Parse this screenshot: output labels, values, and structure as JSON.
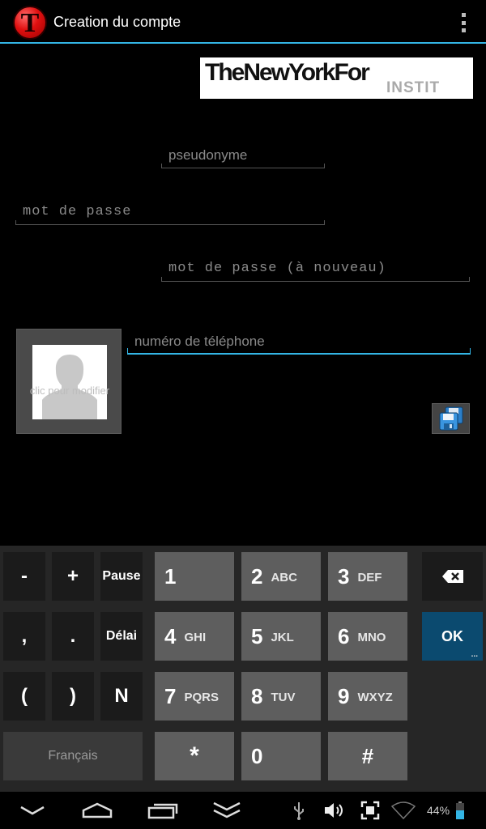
{
  "app": {
    "icon_letter": "T",
    "title": "Creation du compte"
  },
  "logo": {
    "line1": "TheNewYorkFor",
    "line2": "INSTIT"
  },
  "form": {
    "pseudo_hint": "pseudonyme",
    "password_hint": "mot de passe",
    "password_again_hint": "mot de passe (à nouveau)",
    "phone_hint": "numéro de téléphone",
    "avatar_caption": "clic pour modifier"
  },
  "keyboard": {
    "row1": {
      "minus": "-",
      "plus": "+",
      "pause": "Pause",
      "k1": "1",
      "k2": "2",
      "k2_letters": "ABC",
      "k3": "3",
      "k3_letters": "DEF"
    },
    "row2": {
      "comma": ",",
      "dot": ".",
      "delay": "Délai",
      "k4": "4",
      "k4_letters": "GHI",
      "k5": "5",
      "k5_letters": "JKL",
      "k6": "6",
      "k6_letters": "MNO",
      "ok": "OK",
      "ok_dots": "..."
    },
    "row3": {
      "lparen": "(",
      "rparen": ")",
      "n": "N",
      "k7": "7",
      "k7_letters": "PQRS",
      "k8": "8",
      "k8_letters": "TUV",
      "k9": "9",
      "k9_letters": "WXYZ"
    },
    "row4": {
      "lang": "Français",
      "star": "*",
      "k0": "0",
      "hash": "#"
    }
  },
  "status": {
    "battery": "44%"
  },
  "colors": {
    "accent": "#33b5e5",
    "ok_key": "#0b4a6f",
    "icon_red": "#e01010"
  }
}
